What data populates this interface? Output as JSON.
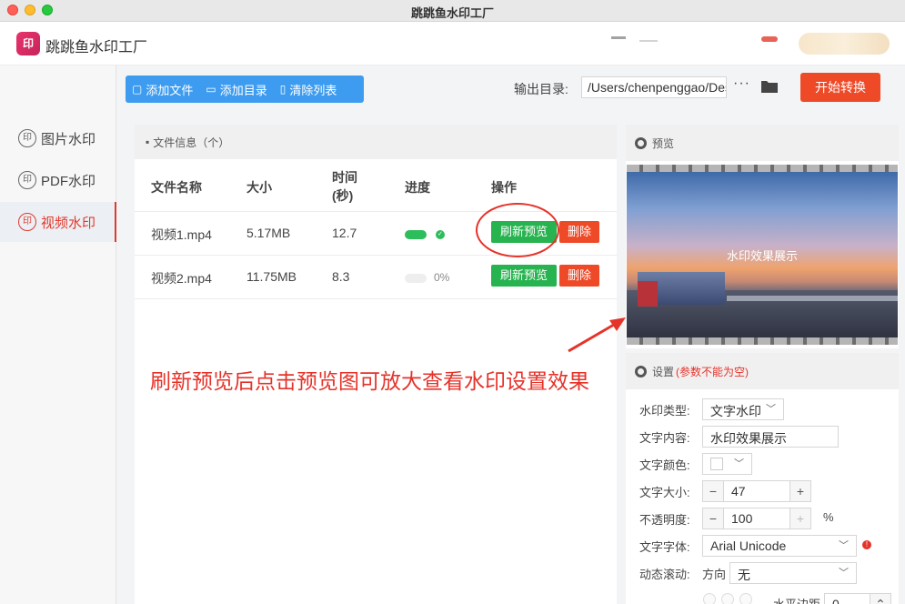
{
  "window": {
    "title": "跳跳鱼水印工厂"
  },
  "app": {
    "logo_text": "印",
    "name": "跳跳鱼水印工厂"
  },
  "sidebar": {
    "items": [
      {
        "icon": "印",
        "label": "图片水印",
        "active": false
      },
      {
        "icon": "印",
        "label": "PDF水印",
        "active": false
      },
      {
        "icon": "印",
        "label": "视频水印",
        "active": true
      }
    ]
  },
  "toolbar": {
    "add_file": "添加文件",
    "add_dir": "添加目录",
    "clear": "清除列表",
    "output_label": "输出目录:",
    "output_path": "/Users/chenpenggao/Desktop",
    "more": "···",
    "start": "开始转换"
  },
  "files": {
    "panel_title": "文件信息（个）",
    "columns": [
      "文件名称",
      "大小",
      "时间(秒)",
      "进度",
      "操作"
    ],
    "rows": [
      {
        "name": "视频1.mp4",
        "size": "5.17MB",
        "time": "12.7",
        "progress": 1.0,
        "progress_label": "✓",
        "refresh": "刷新预览",
        "delete": "删除"
      },
      {
        "name": "视频2.mp4",
        "size": "11.75MB",
        "time": "8.3",
        "progress": 0.0,
        "progress_label": "0%",
        "refresh": "刷新预览",
        "delete": "删除"
      }
    ]
  },
  "annotation": {
    "text": "刷新预览后点击预览图可放大查看水印设置效果"
  },
  "preview": {
    "title": "预览",
    "watermark": "水印效果展示"
  },
  "settings": {
    "title": "设置",
    "note": "(参数不能为空)",
    "type_label": "水印类型:",
    "type_value": "文字水印",
    "content_label": "文字内容:",
    "content_value": "水印效果展示",
    "color_label": "文字颜色:",
    "size_label": "文字大小:",
    "size_value": "47",
    "opacity_label": "不透明度:",
    "opacity_value": "100",
    "opacity_unit": "%",
    "font_label": "文字字体:",
    "font_value": "Arial Unicode",
    "scroll_label": "动态滚动:",
    "direction_label": "方向",
    "direction_value": "无",
    "hmargin_label": "水平边距",
    "hmargin_value": "0"
  },
  "colors": {
    "accent_red": "#ef4a28",
    "accent_blue": "#3d9cf0",
    "accent_green": "#27b34f"
  }
}
